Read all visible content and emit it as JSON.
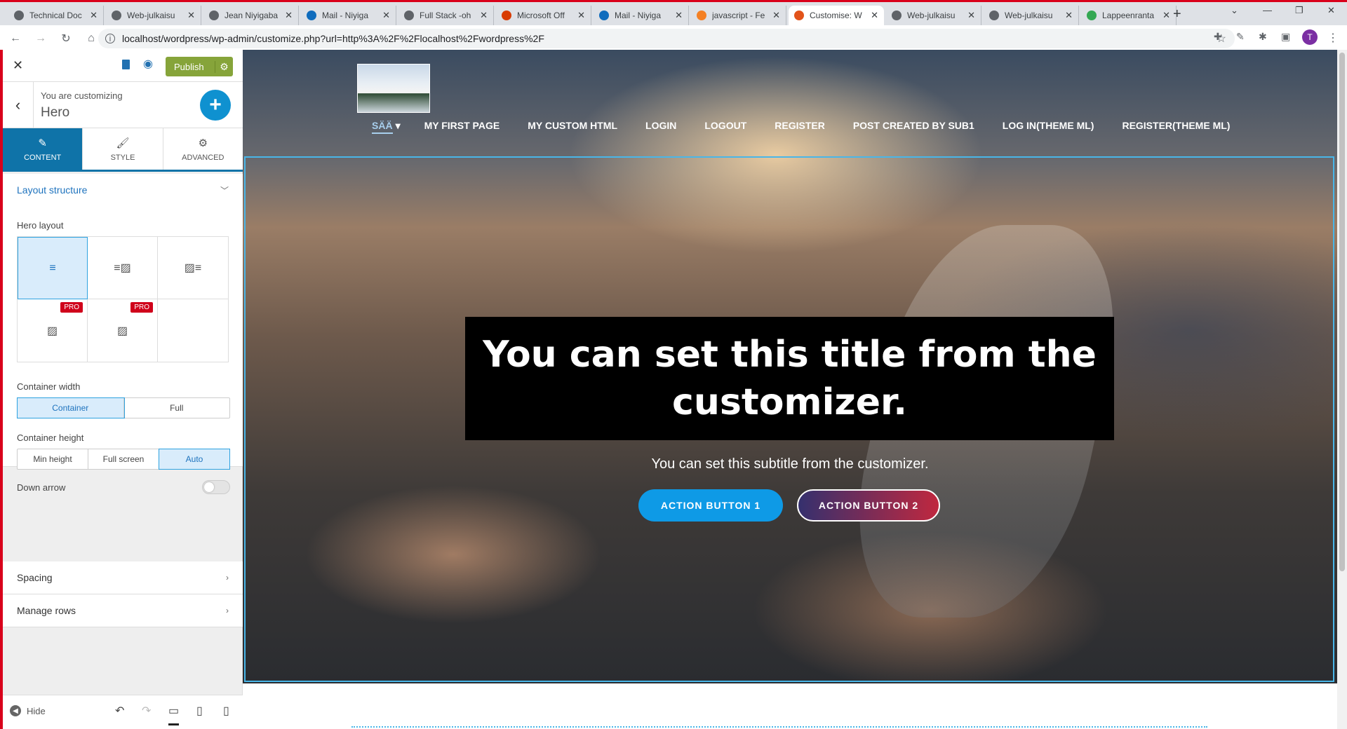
{
  "browser": {
    "tabs": [
      {
        "title": "Technical Doc",
        "color": "#5f6368"
      },
      {
        "title": "Web-julkaisu",
        "color": "#5f6368"
      },
      {
        "title": "Jean Niyigaba",
        "color": "#5f6368"
      },
      {
        "title": "Mail - Niyiga",
        "color": "#0f6cbd"
      },
      {
        "title": "Full Stack -oh",
        "color": "#5f6368"
      },
      {
        "title": "Microsoft Off",
        "color": "#d83b01"
      },
      {
        "title": "Mail - Niyiga",
        "color": "#0f6cbd"
      },
      {
        "title": "javascript - Fe",
        "color": "#f48024"
      },
      {
        "title": "Customise: W",
        "color": "#e2531a"
      },
      {
        "title": "Web-julkaisu",
        "color": "#5f6368"
      },
      {
        "title": "Web-julkaisu",
        "color": "#5f6368"
      },
      {
        "title": "Lappeenranta",
        "color": "#34a853"
      }
    ],
    "active_tab": 8,
    "url": "localhost/wordpress/wp-admin/customize.php?url=http%3A%2F%2Flocalhost%2Fwordpress%2F",
    "profile_initial": "T"
  },
  "panel": {
    "publish_label": "Publish",
    "customizing_label": "You are customizing",
    "customizing_title": "Hero",
    "tabs": [
      {
        "label": "CONTENT",
        "icon": "pencil-icon"
      },
      {
        "label": "STYLE",
        "icon": "brush-icon"
      },
      {
        "label": "ADVANCED",
        "icon": "gears-icon"
      }
    ],
    "layout_structure": "Layout structure",
    "hero_layout_label": "Hero layout",
    "pro_badge": "PRO",
    "container_width_label": "Container width",
    "container_width_options": [
      "Container",
      "Full"
    ],
    "container_width_selected": "Container",
    "container_height_label": "Container height",
    "container_height_options": [
      "Min height",
      "Full screen",
      "Auto"
    ],
    "container_height_selected": "Auto",
    "down_arrow_label": "Down arrow",
    "down_arrow_on": false,
    "spacing_label": "Spacing",
    "manage_rows_label": "Manage rows",
    "hide_label": "Hide"
  },
  "site": {
    "nav": [
      "SÄÄ",
      "MY FIRST PAGE",
      "MY CUSTOM HTML",
      "LOGIN",
      "LOGOUT",
      "REGISTER",
      "POST CREATED BY SUB1",
      "LOG IN(THEME ML)",
      "REGISTER(THEME ML)"
    ],
    "hero_title": "You can set this title from the customizer.",
    "hero_subtitle": "You can set this subtitle from the customizer.",
    "button1": "ACTION BUTTON 1",
    "button2": "ACTION BUTTON 2",
    "accent": "#0e9ae6"
  }
}
